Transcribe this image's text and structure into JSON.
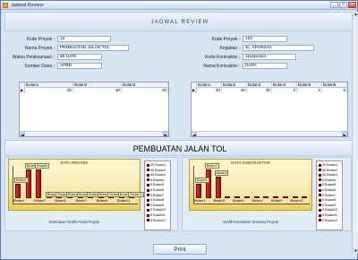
{
  "window": {
    "title": "Jadwal Review"
  },
  "header": {
    "title": "JADWAL REVIEW"
  },
  "form_left": [
    {
      "label": "Kode Proyek :",
      "value": "12"
    },
    {
      "label": "Nama Proyek :",
      "value": "PEMBUATAN JALAN TOL"
    },
    {
      "label": "Waktu Pelaksanaan :",
      "value": "90 HARI"
    },
    {
      "label": "Sumber Dana :",
      "value": "APBD"
    }
  ],
  "form_right": [
    {
      "label": "Kode Proyek :",
      "value": "123"
    },
    {
      "label": "Kegiatan :",
      "value": "JL. APURAYA"
    },
    {
      "label": "Kode Kontraktor :",
      "value": "1111111111"
    },
    {
      "label": "Nama Kontraktor :",
      "value": "DUTA"
    }
  ],
  "grid_left": {
    "headers": [
      "Bulan1",
      "Bulan2",
      "Bulan3"
    ],
    "row": [
      "20",
      "40",
      "40"
    ]
  },
  "grid_right": {
    "headers": [
      "Bulan1",
      "Bulan2",
      "Bulan3",
      "Bulan4",
      "Bulan5",
      "Bulan6"
    ],
    "row": [
      "20",
      "40",
      "30",
      "0",
      "0",
      "0"
    ]
  },
  "banner": {
    "title": "PEMBUATAN JALAN TOL"
  },
  "chart_data": [
    {
      "type": "bar",
      "title": "DATA PROYEK",
      "caption": "Ketentuan Grafik Pada Proyek",
      "categories": [
        "Bulan1",
        "Bulan2",
        "Bulan3",
        "Bulan4",
        "Bulan5",
        "Bulan6",
        "Bulan7",
        "Bulan8",
        "Bulan9",
        "Bulan10",
        "Bulan11",
        "Bulan12"
      ],
      "x_tick_labels": [
        "Bulan1",
        "Bulan3",
        "Bulan5",
        "Bulan7",
        "Bulan9",
        "Bulan11"
      ],
      "values": [
        20,
        40,
        40,
        0,
        0,
        0,
        0,
        0,
        0,
        0,
        0,
        0
      ],
      "point_labels": [
        "Bulan1",
        "Bulan2",
        "Bulan3",
        "Bulan4",
        "Bulan5",
        "Bulan6",
        "Bulan7",
        "Bulan8",
        "Bulan9",
        "Bulan10",
        "Bulan11",
        "Bulan12"
      ],
      "legend": [
        "20 Bulan1",
        "40 Bulan2",
        "40 Bulan3",
        "0 Bulan4",
        "0 Bulan5",
        "0 Bulan6",
        "0 Bulan7",
        "0 Bulan8",
        "0 Bulan9",
        "0 Bulan10",
        "0 Bulan11",
        "0 Bulan12"
      ],
      "ylim": [
        0,
        45
      ]
    },
    {
      "type": "bar",
      "title": "DATA KONTRAKTOR",
      "caption": "Grafik Kontraktor Semasa Proyek",
      "categories": [
        "Bulan1",
        "Bulan2",
        "Bulan3",
        "Bulan4",
        "Bulan5",
        "Bulan6",
        "Bulan7",
        "Bulan8",
        "Bulan9",
        "Bulan10",
        "Bulan11",
        "Bulan12"
      ],
      "x_tick_labels": [
        "Bulan1",
        "Bulan3",
        "Bulan5",
        "Bulan7",
        "Bulan9",
        "Bulan11"
      ],
      "values": [
        20,
        40,
        30,
        0,
        0,
        0,
        0,
        0,
        0,
        0,
        0,
        0
      ],
      "point_labels": [
        "Bulan1",
        "Bulan2",
        "Bulan3"
      ],
      "legend": [
        "20 Bulan1",
        "40 Bulan2",
        "30 Bulan3",
        "0 Bulan4",
        "0 Bulan5",
        "0 Bulan6",
        "0 Bulan7",
        "0 Bulan8",
        "0 Bulan9",
        "0 Bulan10",
        "0 Bulan11",
        "0 Bulan12"
      ],
      "ylim": [
        0,
        45
      ]
    }
  ],
  "buttons": {
    "print": "Print",
    "minimize": "_",
    "maximize": "□",
    "close": "×"
  },
  "colors": {
    "bar": "#c81818",
    "chart_bg": "#f6e08a",
    "window_bg": "#d6e4f4"
  }
}
